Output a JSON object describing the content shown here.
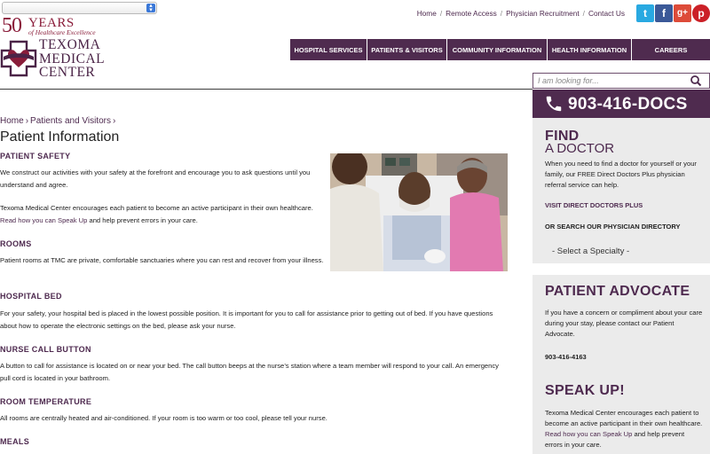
{
  "header": {
    "logo": {
      "years_number": "50",
      "years_word": "YEARS",
      "tagline": "of Healthcare Excellence",
      "name_lines": [
        "TEXOMA",
        "MEDICAL",
        "CENTER"
      ]
    },
    "utility_links": [
      "Home",
      "Remote Access",
      "Physician Recruitment",
      "Contact Us"
    ],
    "social": [
      {
        "icon": "twitter-icon",
        "glyph": "t",
        "color": "#29a9e1"
      },
      {
        "icon": "facebook-icon",
        "glyph": "f",
        "color": "#3b5998"
      },
      {
        "icon": "google-plus-icon",
        "glyph": "g+",
        "color": "#dd4b39"
      },
      {
        "icon": "pinterest-icon",
        "glyph": "p",
        "color": "#cb2027"
      }
    ],
    "nav": [
      "HOSPITAL SERVICES",
      "PATIENTS & VISITORS",
      "COMMUNITY INFORMATION",
      "HEALTH INFORMATION",
      "CAREERS"
    ],
    "search": {
      "placeholder": "I am looking for..."
    }
  },
  "main": {
    "breadcrumb": [
      "Home",
      "Patients and Visitors"
    ],
    "title": "Patient Information",
    "sections": [
      {
        "heading": "PATIENT SAFETY",
        "p1": "We construct our activities with your safety at the forefront and encourage you to ask questions until you understand and agree.",
        "p2_text": "Texoma Medical Center encourages each patient to become an active participant in their own healthcare.",
        "p2_link": "Read how you can Speak Up",
        "p2_tail": "and help prevent errors in your care."
      },
      {
        "heading": "ROOMS",
        "p1": "Patient rooms at TMC are private, comfortable sanctuaries where you can rest and recover from your illness."
      },
      {
        "heading": "HOSPITAL BED",
        "p1": "For your safety, your hospital bed is placed in the lowest possible position. It is important for you to call for assistance prior to getting out of bed. If you have questions about how to operate the electronic settings on the bed, please ask your nurse."
      },
      {
        "heading": "NURSE CALL BUTTON",
        "p1": "A button to call for assistance is located on or near your bed. The call button beeps at the nurse’s station where a team member will respond to your call. An emergency pull cord is located in your bathroom."
      },
      {
        "heading": "ROOM TEMPERATURE",
        "p1": "All rooms are centrally heated and air-conditioned. If your room is too warm or too cool, please tell your nurse."
      },
      {
        "heading": "MEALS"
      }
    ]
  },
  "sidebar": {
    "phone": "903-416-DOCS",
    "find_doctor": {
      "title_line1": "FIND",
      "title_line2": "A DOCTOR",
      "text": "When you need to find a doctor for yourself or your family, our FREE Direct Doctors Plus physician referral service can help.",
      "visit_link": "VISIT DIRECT DOCTORS PLUS",
      "search_label": "OR SEARCH OUR PHYSICIAN DIRECTORY",
      "specialty_select": "- Select a Specialty -"
    },
    "advocate": {
      "title": "PATIENT ADVOCATE",
      "text": "If you have a concern or compliment about your care during your stay, please contact our Patient Advocate.",
      "phone": "903-416-4163"
    },
    "speak_up": {
      "title": "SPEAK UP!",
      "text": "Texoma Medical Center encourages each patient to become an active participant in their own healthcare.",
      "link": "Read how you can Speak Up",
      "tail": "and help prevent errors in your care."
    }
  },
  "colors": {
    "brand_purple": "#4f2b4f",
    "logo_red": "#8a1d3a",
    "sidebar_gray": "#ebebeb"
  }
}
